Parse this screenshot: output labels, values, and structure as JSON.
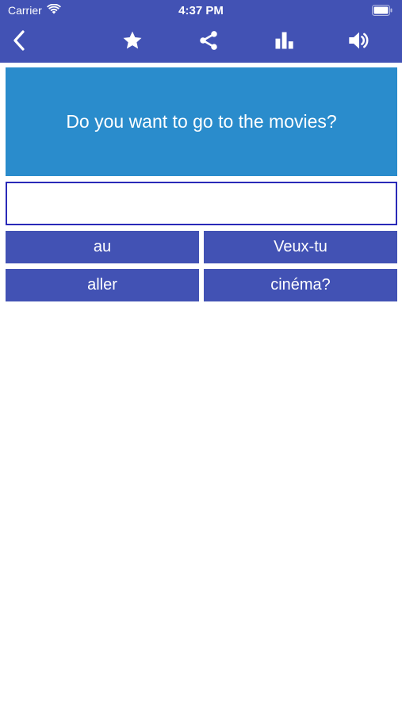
{
  "status_bar": {
    "carrier": "Carrier",
    "time": "4:37 PM"
  },
  "toolbar": {
    "icons": [
      "back-icon",
      "star-icon",
      "share-icon",
      "bar-chart-icon",
      "speaker-icon"
    ]
  },
  "colors": {
    "header": "#4252b4",
    "question_bg": "#2a8ccc",
    "answer_border": "#2a2ab8",
    "word_button": "#4252b4"
  },
  "question": {
    "text": "Do you want to go to the movies?"
  },
  "answer": {
    "value": ""
  },
  "word_choices": [
    "au",
    "Veux-tu",
    "aller",
    "cinéma?"
  ]
}
